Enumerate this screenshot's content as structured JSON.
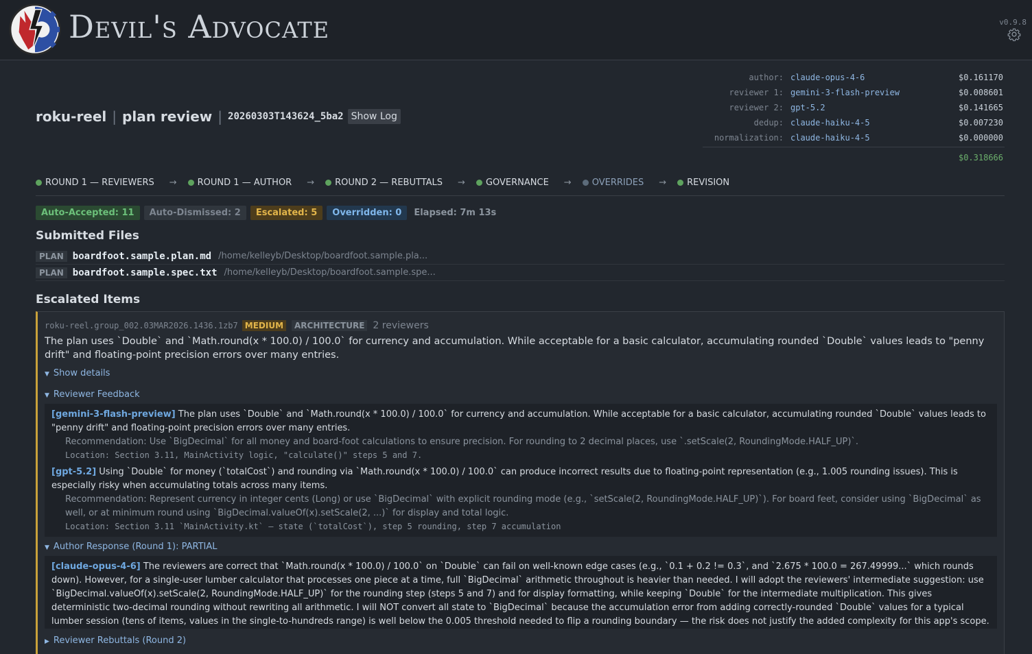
{
  "app": {
    "title": "Devil's Advocate",
    "version": "v0.9.8"
  },
  "run": {
    "project": "roku-reel",
    "mode": "plan review",
    "id": "20260303T143624_5ba2",
    "show_log": "Show Log"
  },
  "costs": [
    {
      "role": "author:",
      "model": "claude-opus-4-6",
      "amount": "$0.161170"
    },
    {
      "role": "reviewer 1:",
      "model": "gemini-3-flash-preview",
      "amount": "$0.008601"
    },
    {
      "role": "reviewer 2:",
      "model": "gpt-5.2",
      "amount": "$0.141665"
    },
    {
      "role": "dedup:",
      "model": "claude-haiku-4-5",
      "amount": "$0.007230"
    },
    {
      "role": "normalization:",
      "model": "claude-haiku-4-5",
      "amount": "$0.000000"
    }
  ],
  "cost_total": "$0.318666",
  "pipeline": [
    {
      "label": "ROUND 1 — REVIEWERS",
      "status": "done"
    },
    {
      "label": "ROUND 1 — AUTHOR",
      "status": "done"
    },
    {
      "label": "ROUND 2 — REBUTTALS",
      "status": "done"
    },
    {
      "label": "GOVERNANCE",
      "status": "done"
    },
    {
      "label": "OVERRIDES",
      "status": "pending"
    },
    {
      "label": "REVISION",
      "status": "done"
    }
  ],
  "pipeline_arrow": "→",
  "stats": {
    "accepted": "Auto-Accepted: 11",
    "dismissed": "Auto-Dismissed: 2",
    "escalated": "Escalated: 5",
    "overridden": "Overridden: 0",
    "elapsed": "Elapsed: 7m 13s"
  },
  "submitted": {
    "heading": "Submitted Files",
    "files": [
      {
        "tag": "PLAN",
        "name": "boardfoot.sample.plan.md",
        "path": "/home/kelleyb/Desktop/boardfoot.sample.pla..."
      },
      {
        "tag": "PLAN",
        "name": "boardfoot.sample.spec.txt",
        "path": "/home/kelleyb/Desktop/boardfoot.sample.spe..."
      }
    ]
  },
  "escalated": {
    "heading": "Escalated Items",
    "item": {
      "id": "roku-reel.group_002.03MAR2026.1436.1zb7",
      "severity": "MEDIUM",
      "category": "ARCHITECTURE",
      "reviewers": "2 reviewers",
      "summary": "The plan uses `Double` and `Math.round(x * 100.0) / 100.0` for currency and accumulation. While acceptable for a basic calculator, accumulating rounded `Double` values leads to \"penny drift\" and floating-point precision errors over many entries.",
      "show_details": "Show details",
      "feedback_label": "Reviewer Feedback",
      "feedback": [
        {
          "who": "[gemini-3-flash-preview]",
          "text": " The plan uses `Double` and `Math.round(x * 100.0) / 100.0` for currency and accumulation. While acceptable for a basic calculator, accumulating rounded `Double` values leads to \"penny drift\" and floating-point precision errors over many entries.",
          "recommendation": "Recommendation: Use `BigDecimal` for all money and board-foot calculations to ensure precision. For rounding to 2 decimal places, use `.setScale(2, RoundingMode.HALF_UP)`.",
          "location": "Location: Section 3.11, MainActivity logic, \"calculate()\" steps 5 and 7."
        },
        {
          "who": "[gpt-5.2]",
          "text": " Using `Double` for money (`totalCost`) and rounding via `Math.round(x * 100.0) / 100.0` can produce incorrect results due to floating-point representation (e.g., 1.005 rounding issues). This is especially risky when accumulating totals across many items.",
          "recommendation": "Recommendation: Represent currency in integer cents (Long) or use `BigDecimal` with explicit rounding mode (e.g., `setScale(2, RoundingMode.HALF_UP)`). For board feet, consider using `BigDecimal` as well, or at minimum round using `BigDecimal.valueOf(x).setScale(2, ...)` for display and total logic.",
          "location": "Location: Section 3.11 `MainActivity.kt` — state (`totalCost`), step 5 rounding, step 7 accumulation"
        }
      ],
      "author_label": "Author Response (Round 1): PARTIAL",
      "author_who": "[claude-opus-4-6]",
      "author_text": " The reviewers are correct that `Math.round(x * 100.0) / 100.0` on `Double` can fail on well-known edge cases (e.g., `0.1 + 0.2 != 0.3`, and `2.675 * 100.0 = 267.49999...` which rounds down). However, for a single-user lumber calculator that processes one piece at a time, full `BigDecimal` arithmetic throughout is heavier than needed. I will adopt the reviewers' intermediate suggestion: use `BigDecimal.valueOf(x).setScale(2, RoundingMode.HALF_UP)` for the rounding step (steps 5 and 7) and for display formatting, while keeping `Double` for the intermediate multiplication. This gives deterministic two-decimal rounding without rewriting all arithmetic. I will NOT convert all state to `BigDecimal` because the accumulation error from adding correctly-rounded `Double` values for a typical lumber session (tens of items, values in the single-to-hundreds range) is well below the 0.005 threshold needed to flip a rounding boundary — the risk does not justify the added complexity for this app's scope.",
      "rebuttals_label": "Reviewer Rebuttals (Round 2)"
    }
  },
  "colors": {
    "accent_escalated": "#c9a13a",
    "done": "#5ea35e",
    "pending": "#5c6b7a"
  }
}
